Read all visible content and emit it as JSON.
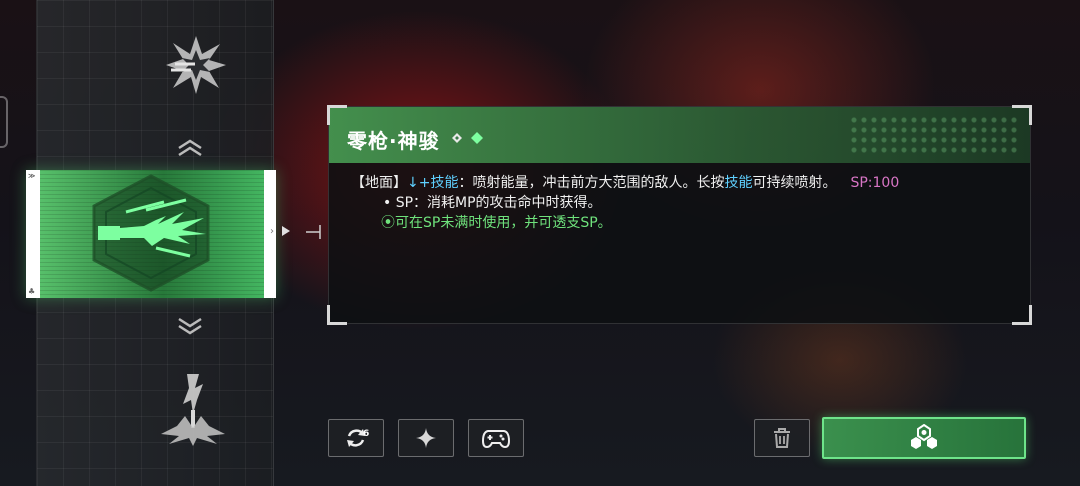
{
  "skill": {
    "name": "零枪·神骏",
    "desc_prefix": "【地面】",
    "desc_input": "↓+技能",
    "desc_text": "：喷射能量，冲击前方大范围的敌人。长按",
    "desc_key": "技能",
    "desc_suffix": "可持续喷射。",
    "sp_cost": "SP:100",
    "sp_note": "• SP：消耗MP的攻击命中时获得。",
    "condition_note": "⦿可在SP未满时使用，并可透支SP。"
  },
  "card_marks": {
    "corner_top": "≫",
    "corner_bottom": "♣",
    "arrow_right": "›"
  },
  "colors": {
    "accent_green": "#6fe27c",
    "highlight_cyan": "#5fd0ff",
    "sp_pink": "#d875c5"
  },
  "icons": {
    "swap": "swap-icon",
    "swap_badge": "6",
    "star": "sparkle-icon",
    "gamepad": "gamepad-icon",
    "trash": "trash-icon",
    "equip": "equip-emblem-icon"
  }
}
